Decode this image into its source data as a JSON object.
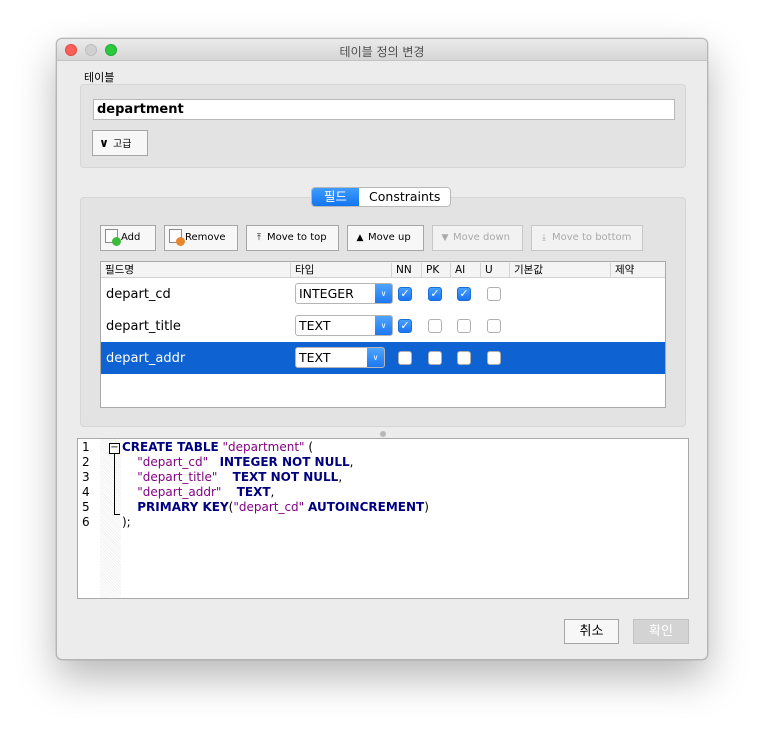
{
  "window": {
    "title": "테이블 정의 변경"
  },
  "table_section": {
    "label": "테이블",
    "name_value": "department",
    "advanced_label": "고급"
  },
  "tabs": [
    {
      "label": "필드",
      "active": true
    },
    {
      "label": "Constraints",
      "active": false
    }
  ],
  "toolbar": {
    "add": "Add",
    "remove": "Remove",
    "move_top": "Move to top",
    "move_up": "Move up",
    "move_down": "Move down",
    "move_bottom": "Move to bottom"
  },
  "grid": {
    "headers": [
      "필드명",
      "타입",
      "NN",
      "PK",
      "AI",
      "U",
      "기본값",
      "제약"
    ],
    "rows": [
      {
        "name": "depart_cd",
        "type": "INTEGER",
        "nn": true,
        "pk": true,
        "ai": true,
        "u": false,
        "selected": false
      },
      {
        "name": "depart_title",
        "type": "TEXT",
        "nn": true,
        "pk": false,
        "ai": false,
        "u": false,
        "selected": false
      },
      {
        "name": "depart_addr",
        "type": "TEXT",
        "nn": false,
        "pk": false,
        "ai": false,
        "u": false,
        "selected": true
      }
    ]
  },
  "sql": {
    "line_numbers": [
      "1",
      "2",
      "3",
      "4",
      "5",
      "6"
    ],
    "line1": {
      "kw": "CREATE TABLE",
      "str": "\"department\"",
      "rest": " ("
    },
    "line2": {
      "str": "\"depart_cd\"",
      "kw": "INTEGER NOT NULL",
      "rest": ","
    },
    "line3": {
      "str": "\"depart_title\"",
      "kw": "TEXT NOT NULL",
      "rest": ","
    },
    "line4": {
      "str": "\"depart_addr\"",
      "kw": "TEXT",
      "rest": ","
    },
    "line5": {
      "kw": "PRIMARY KEY",
      "open": "(",
      "str": "\"depart_cd\"",
      "kw2": "AUTOINCREMENT",
      "close": ")"
    },
    "line6": ");"
  },
  "footer": {
    "cancel": "취소",
    "ok": "확인"
  },
  "colors": {
    "accent": "#0f62d1",
    "keyword": "#00007f",
    "string": "#7f007f",
    "close": "#fc5f57",
    "maximize": "#2ac940"
  }
}
